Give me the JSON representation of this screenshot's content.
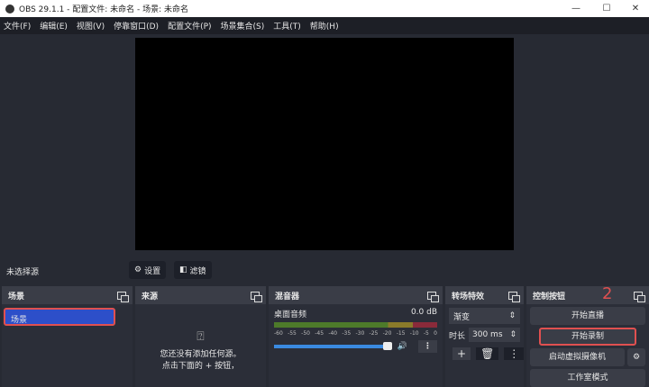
{
  "title": "OBS 29.1.1 - 配置文件: 未命名 - 场景: 未命名",
  "window_controls": [
    "—",
    "☐",
    "✕"
  ],
  "menu": [
    "文件(F)",
    "编辑(E)",
    "视图(V)",
    "停靠窗口(D)",
    "配置文件(P)",
    "场景集合(S)",
    "工具(T)",
    "帮助(H)"
  ],
  "source_bar": {
    "label": "未选择源",
    "settings": "设置",
    "filters": "滤镜"
  },
  "scenes": {
    "title": "场景",
    "items": [
      "场景"
    ]
  },
  "sources": {
    "title": "来源",
    "empty_line1": "您还没有添加任何源。",
    "empty_line2": "点击下面的 + 按钮，"
  },
  "mixer": {
    "title": "混音器",
    "channel": "桌面音频",
    "level": "0.0 dB",
    "ticks": [
      "-60",
      "-55",
      "-50",
      "-45",
      "-40",
      "-35",
      "-30",
      "-25",
      "-20",
      "-15",
      "-10",
      "-5",
      "0"
    ],
    "volume": 0.95
  },
  "transitions": {
    "title": "转场特效",
    "selected": "渐变",
    "duration_label": "时长",
    "duration": "300 ms"
  },
  "controls": {
    "title": "控制按钮",
    "annotation": "2",
    "start_stream": "开始直播",
    "start_record": "开始录制",
    "virtual_cam": "启动虚拟摄像机",
    "studio_mode": "工作室模式"
  }
}
